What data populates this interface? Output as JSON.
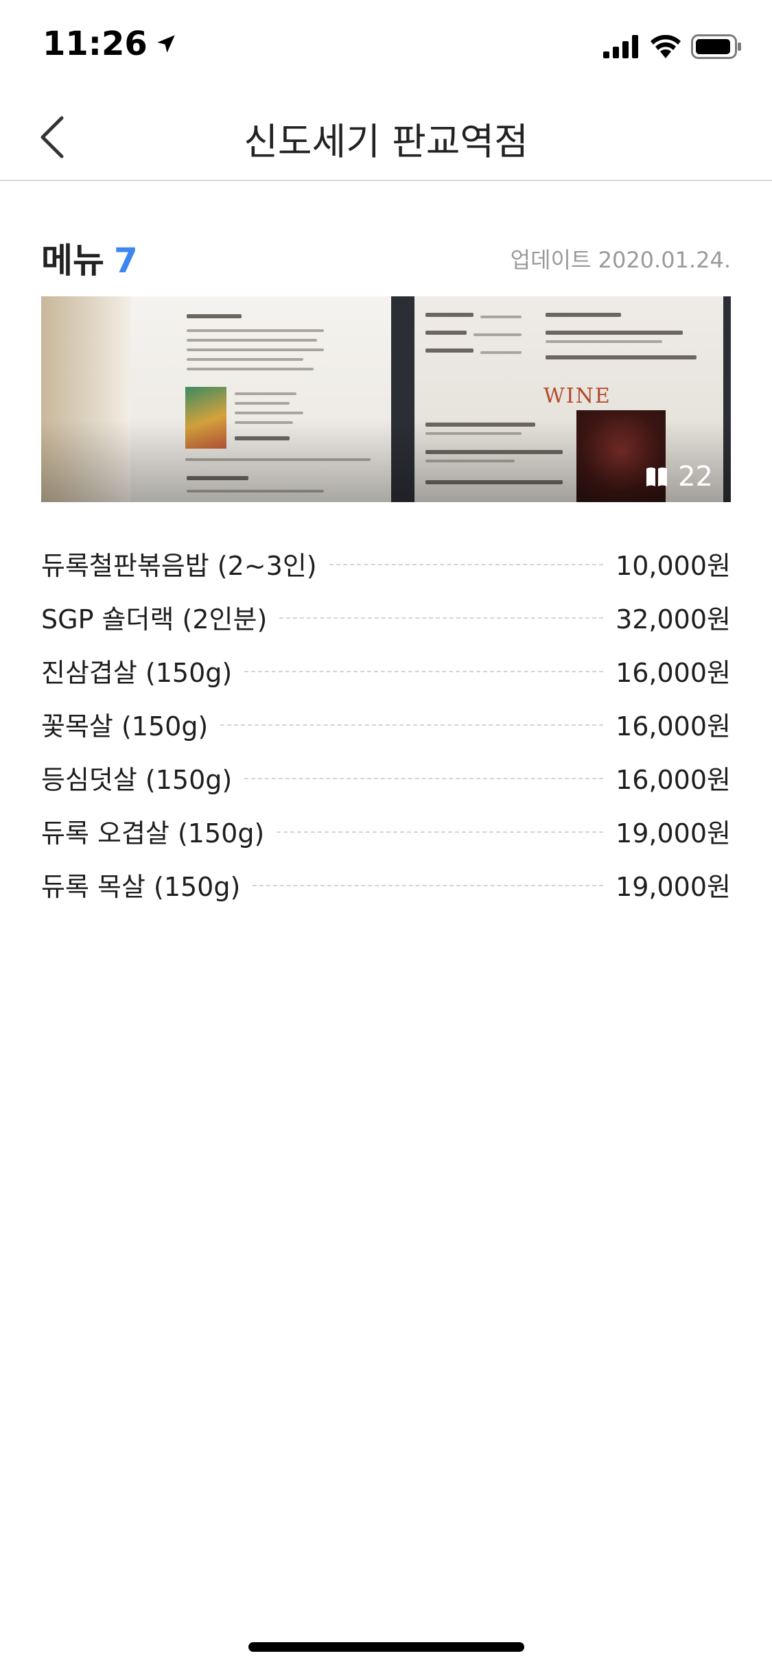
{
  "status_bar": {
    "time": "11:26",
    "icons": [
      "location-arrow-icon",
      "cellular-signal-icon",
      "wifi-icon",
      "battery-icon"
    ]
  },
  "nav": {
    "title": "신도세기 판교역점",
    "back_icon": "chevron-left-icon"
  },
  "menu_section": {
    "title": "메뉴",
    "count": "7",
    "updated": "업데이트 2020.01.24.",
    "count_color": "#3b86f0"
  },
  "photo": {
    "badge_icon": "book-icon",
    "photo_count": "22",
    "wine_text": "WINE"
  },
  "menu_items": [
    {
      "name": "듀록철판볶음밥 (2~3인)",
      "price": "10,000원"
    },
    {
      "name": "SGP 숄더랙 (2인분)",
      "price": "32,000원"
    },
    {
      "name": "진삼겹살 (150g)",
      "price": "16,000원"
    },
    {
      "name": "꽃목살 (150g)",
      "price": "16,000원"
    },
    {
      "name": "등심덧살 (150g)",
      "price": "16,000원"
    },
    {
      "name": "듀록 오겹살 (150g)",
      "price": "19,000원"
    },
    {
      "name": "듀록 목살 (150g)",
      "price": "19,000원"
    }
  ]
}
